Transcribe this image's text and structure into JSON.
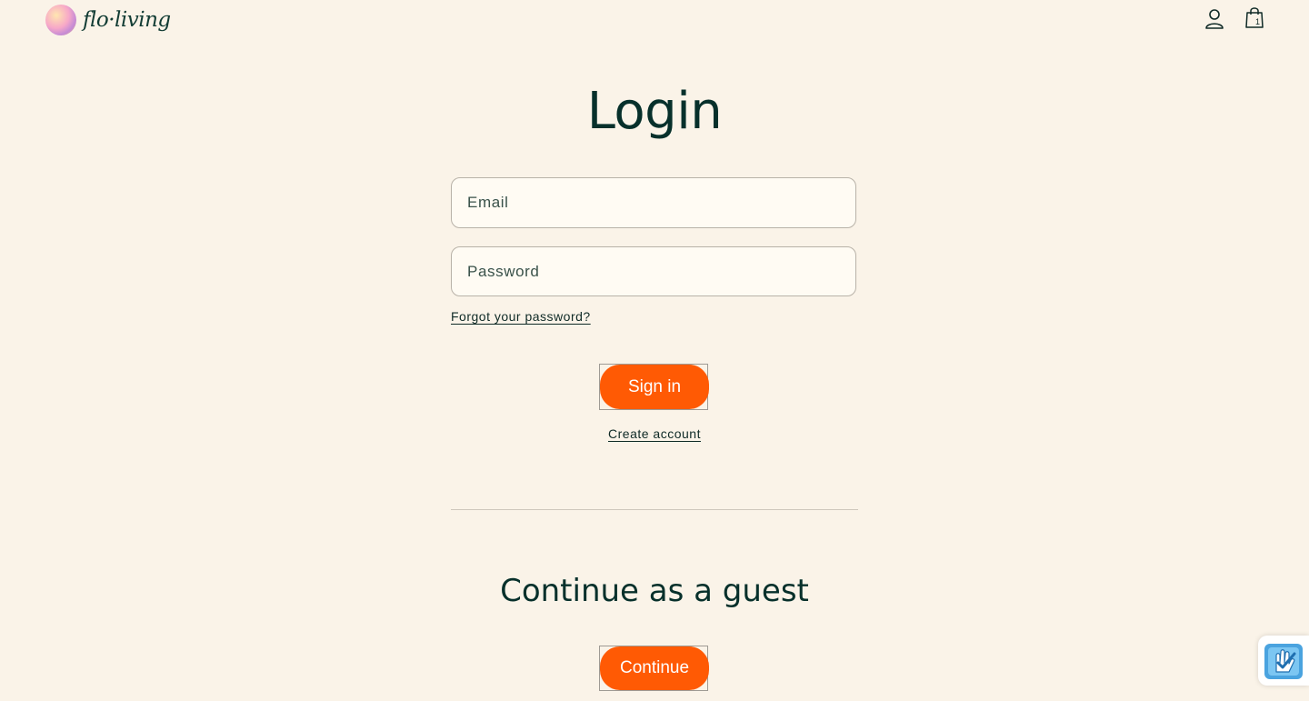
{
  "header": {
    "logo_text": "flo·living",
    "account_icon": "user-icon",
    "cart_icon": "shopping-bag-icon",
    "cart_count": "1"
  },
  "login": {
    "title": "Login",
    "email_placeholder": "Email",
    "password_placeholder": "Password",
    "forgot_link": "Forgot your password?",
    "signin_button": "Sign in",
    "create_account_link": "Create account"
  },
  "guest": {
    "title": "Continue as a guest",
    "continue_button": "Continue"
  },
  "widget": {
    "icon": "accessibility-hand-icon"
  },
  "colors": {
    "background": "#faf3e8",
    "accent": "#ff5a04",
    "text_dark": "#07302b"
  }
}
